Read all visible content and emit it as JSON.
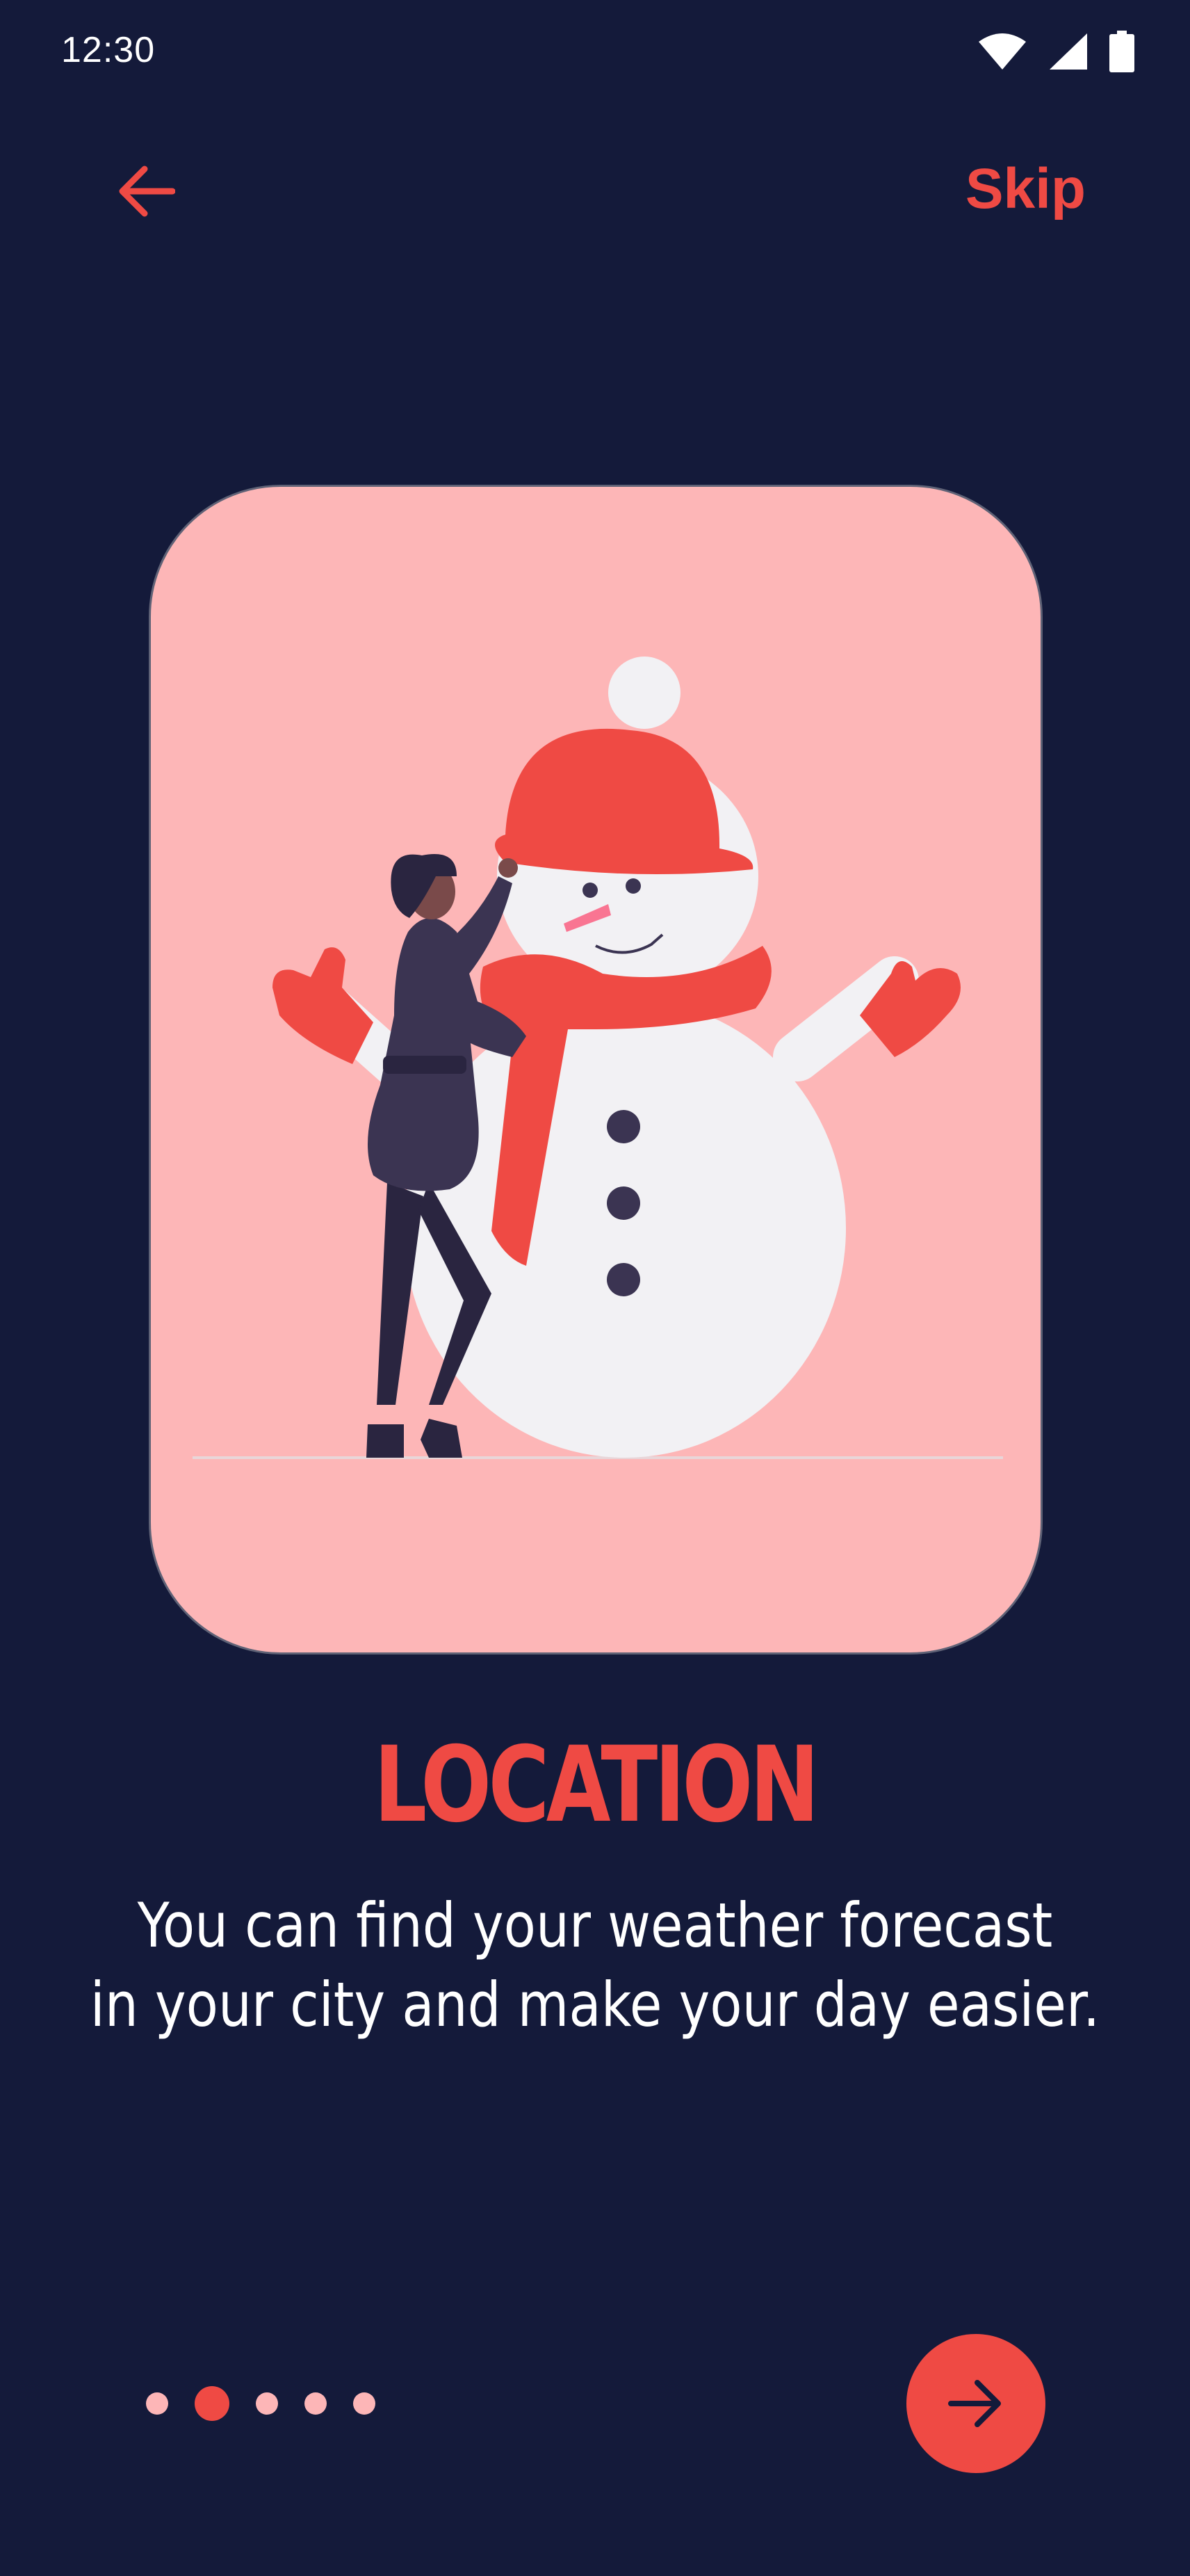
{
  "status_bar": {
    "time": "12:30",
    "icons": [
      "wifi-icon",
      "cellular-signal-icon",
      "battery-icon"
    ]
  },
  "header": {
    "back_icon": "arrow-left-icon",
    "skip_label": "Skip"
  },
  "illustration": {
    "description_icon": "snowman-illustration"
  },
  "content": {
    "title": "LOCATION",
    "description_lines": [
      "You can find your weather forecast",
      "in your city and make your day easier."
    ]
  },
  "pager": {
    "total_pages": 5,
    "current_page": 2
  },
  "next_button": {
    "icon": "arrow-right-icon"
  },
  "colors": {
    "background": "#141a3a",
    "accent": "#ef4a44",
    "card_background": "#fdb6b7",
    "inactive_dot": "#fdb6b7",
    "text": "#ffffff"
  }
}
